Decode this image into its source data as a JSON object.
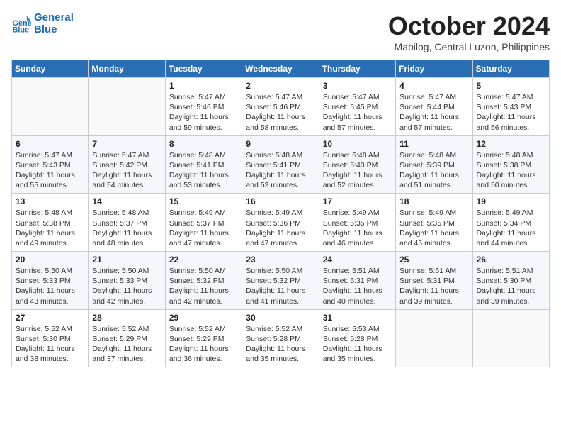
{
  "header": {
    "logo_line1": "General",
    "logo_line2": "Blue",
    "month": "October 2024",
    "location": "Mabilog, Central Luzon, Philippines"
  },
  "days_of_week": [
    "Sunday",
    "Monday",
    "Tuesday",
    "Wednesday",
    "Thursday",
    "Friday",
    "Saturday"
  ],
  "weeks": [
    [
      {
        "day": "",
        "detail": ""
      },
      {
        "day": "",
        "detail": ""
      },
      {
        "day": "1",
        "detail": "Sunrise: 5:47 AM\nSunset: 5:46 PM\nDaylight: 11 hours\nand 59 minutes."
      },
      {
        "day": "2",
        "detail": "Sunrise: 5:47 AM\nSunset: 5:46 PM\nDaylight: 11 hours\nand 58 minutes."
      },
      {
        "day": "3",
        "detail": "Sunrise: 5:47 AM\nSunset: 5:45 PM\nDaylight: 11 hours\nand 57 minutes."
      },
      {
        "day": "4",
        "detail": "Sunrise: 5:47 AM\nSunset: 5:44 PM\nDaylight: 11 hours\nand 57 minutes."
      },
      {
        "day": "5",
        "detail": "Sunrise: 5:47 AM\nSunset: 5:43 PM\nDaylight: 11 hours\nand 56 minutes."
      }
    ],
    [
      {
        "day": "6",
        "detail": "Sunrise: 5:47 AM\nSunset: 5:43 PM\nDaylight: 11 hours\nand 55 minutes."
      },
      {
        "day": "7",
        "detail": "Sunrise: 5:47 AM\nSunset: 5:42 PM\nDaylight: 11 hours\nand 54 minutes."
      },
      {
        "day": "8",
        "detail": "Sunrise: 5:48 AM\nSunset: 5:41 PM\nDaylight: 11 hours\nand 53 minutes."
      },
      {
        "day": "9",
        "detail": "Sunrise: 5:48 AM\nSunset: 5:41 PM\nDaylight: 11 hours\nand 52 minutes."
      },
      {
        "day": "10",
        "detail": "Sunrise: 5:48 AM\nSunset: 5:40 PM\nDaylight: 11 hours\nand 52 minutes."
      },
      {
        "day": "11",
        "detail": "Sunrise: 5:48 AM\nSunset: 5:39 PM\nDaylight: 11 hours\nand 51 minutes."
      },
      {
        "day": "12",
        "detail": "Sunrise: 5:48 AM\nSunset: 5:38 PM\nDaylight: 11 hours\nand 50 minutes."
      }
    ],
    [
      {
        "day": "13",
        "detail": "Sunrise: 5:48 AM\nSunset: 5:38 PM\nDaylight: 11 hours\nand 49 minutes."
      },
      {
        "day": "14",
        "detail": "Sunrise: 5:48 AM\nSunset: 5:37 PM\nDaylight: 11 hours\nand 48 minutes."
      },
      {
        "day": "15",
        "detail": "Sunrise: 5:49 AM\nSunset: 5:37 PM\nDaylight: 11 hours\nand 47 minutes."
      },
      {
        "day": "16",
        "detail": "Sunrise: 5:49 AM\nSunset: 5:36 PM\nDaylight: 11 hours\nand 47 minutes."
      },
      {
        "day": "17",
        "detail": "Sunrise: 5:49 AM\nSunset: 5:35 PM\nDaylight: 11 hours\nand 46 minutes."
      },
      {
        "day": "18",
        "detail": "Sunrise: 5:49 AM\nSunset: 5:35 PM\nDaylight: 11 hours\nand 45 minutes."
      },
      {
        "day": "19",
        "detail": "Sunrise: 5:49 AM\nSunset: 5:34 PM\nDaylight: 11 hours\nand 44 minutes."
      }
    ],
    [
      {
        "day": "20",
        "detail": "Sunrise: 5:50 AM\nSunset: 5:33 PM\nDaylight: 11 hours\nand 43 minutes."
      },
      {
        "day": "21",
        "detail": "Sunrise: 5:50 AM\nSunset: 5:33 PM\nDaylight: 11 hours\nand 42 minutes."
      },
      {
        "day": "22",
        "detail": "Sunrise: 5:50 AM\nSunset: 5:32 PM\nDaylight: 11 hours\nand 42 minutes."
      },
      {
        "day": "23",
        "detail": "Sunrise: 5:50 AM\nSunset: 5:32 PM\nDaylight: 11 hours\nand 41 minutes."
      },
      {
        "day": "24",
        "detail": "Sunrise: 5:51 AM\nSunset: 5:31 PM\nDaylight: 11 hours\nand 40 minutes."
      },
      {
        "day": "25",
        "detail": "Sunrise: 5:51 AM\nSunset: 5:31 PM\nDaylight: 11 hours\nand 39 minutes."
      },
      {
        "day": "26",
        "detail": "Sunrise: 5:51 AM\nSunset: 5:30 PM\nDaylight: 11 hours\nand 39 minutes."
      }
    ],
    [
      {
        "day": "27",
        "detail": "Sunrise: 5:52 AM\nSunset: 5:30 PM\nDaylight: 11 hours\nand 38 minutes."
      },
      {
        "day": "28",
        "detail": "Sunrise: 5:52 AM\nSunset: 5:29 PM\nDaylight: 11 hours\nand 37 minutes."
      },
      {
        "day": "29",
        "detail": "Sunrise: 5:52 AM\nSunset: 5:29 PM\nDaylight: 11 hours\nand 36 minutes."
      },
      {
        "day": "30",
        "detail": "Sunrise: 5:52 AM\nSunset: 5:28 PM\nDaylight: 11 hours\nand 35 minutes."
      },
      {
        "day": "31",
        "detail": "Sunrise: 5:53 AM\nSunset: 5:28 PM\nDaylight: 11 hours\nand 35 minutes."
      },
      {
        "day": "",
        "detail": ""
      },
      {
        "day": "",
        "detail": ""
      }
    ]
  ]
}
